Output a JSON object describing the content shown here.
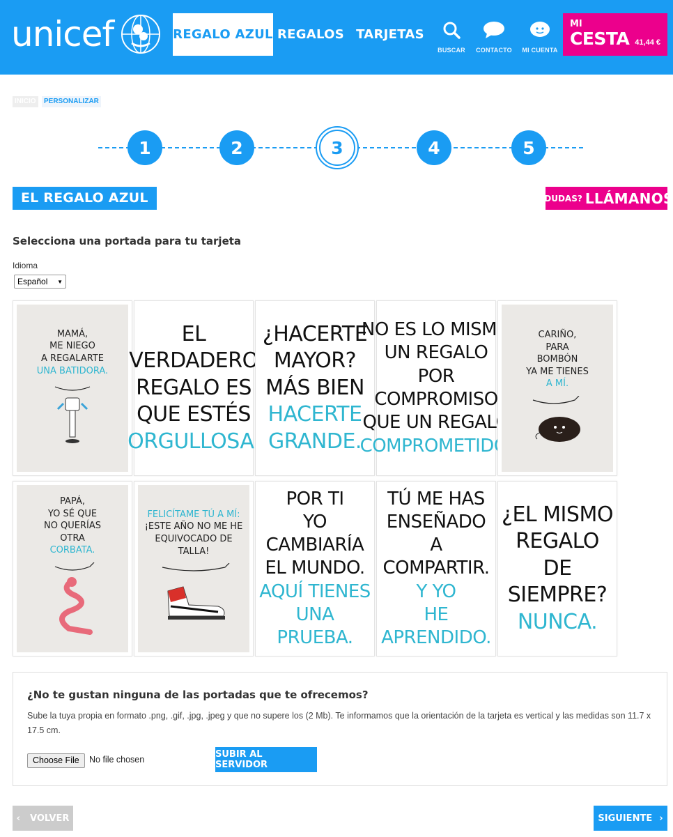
{
  "header": {
    "logo_text": "unicef",
    "nav": [
      {
        "label": "REGALO AZUL",
        "active": true
      },
      {
        "label": "REGALOS",
        "active": false
      },
      {
        "label": "TARJETAS",
        "active": false
      }
    ],
    "icons": [
      {
        "icon": "search-icon",
        "label": "BUSCAR"
      },
      {
        "icon": "chat-icon",
        "label": "CONTACTO"
      },
      {
        "icon": "user-icon",
        "label": "MI CUENTA"
      }
    ],
    "cart": {
      "mi": "MI",
      "cesta": "CESTA",
      "total": "41,44 €"
    },
    "colors": {
      "primary": "#1a9cf3",
      "accent": "#ec008c"
    }
  },
  "breadcrumb": [
    "INICIO",
    "PERSONALIZAR"
  ],
  "steps": {
    "items": [
      "1",
      "2",
      "3",
      "4",
      "5"
    ],
    "current": 3
  },
  "section": {
    "title": "EL REGALO AZUL",
    "help_small": "¿DUDAS?",
    "help_big": "LLÁMANOS",
    "subtitle": "Selecciona una portada para tu tarjeta",
    "language_label": "Idioma",
    "language_value": "Español"
  },
  "cards": [
    {
      "style": "small",
      "bg": "gray",
      "lines": [
        "MAMÁ,",
        "ME NIEGO",
        "A REGALARTE"
      ],
      "blue": [
        "UNA BATIDORA."
      ],
      "illustration": "mixer-icon"
    },
    {
      "style": "big",
      "bg": "white",
      "lines": [
        "EL VERDADERO",
        "REGALO ES",
        "QUE ESTÉS"
      ],
      "blue": [
        "ORGULLOSA."
      ]
    },
    {
      "style": "big",
      "bg": "white",
      "lines": [
        "¿HACERTE",
        "MAYOR?",
        "MÁS BIEN"
      ],
      "blue": [
        "HACERTE",
        "GRANDE."
      ]
    },
    {
      "style": "bigsm",
      "bg": "white",
      "lines": [
        "NO ES LO MISMO",
        "UN REGALO",
        "POR COMPROMISO",
        "QUE UN REGALO"
      ],
      "blue": [
        "COMPROMETIDO."
      ]
    },
    {
      "style": "small",
      "bg": "gray",
      "lines": [
        "CARIÑO,",
        "PARA",
        "BOMBÓN",
        "YA ME TIENES"
      ],
      "blue": [
        "A MÍ."
      ],
      "illustration": "chocolate-icon"
    },
    {
      "style": "small",
      "bg": "gray",
      "lines": [
        "PAPÁ,",
        "YO SÉ QUE",
        "NO QUERÍAS",
        "OTRA"
      ],
      "blue": [
        "CORBATA."
      ],
      "illustration": "tie-icon"
    },
    {
      "style": "small",
      "bg": "gray",
      "lines_pre_blue": [
        "FELICÍTAME TÚ A MÍ:"
      ],
      "lines": [
        "¡ESTE AÑO NO ME HE",
        "EQUIVOCADO DE TALLA!"
      ],
      "blue": [],
      "illustration": "sneaker-icon"
    },
    {
      "style": "bigsm",
      "bg": "white",
      "lines": [
        "POR TI",
        "YO CAMBIARÍA",
        "EL MUNDO."
      ],
      "blue": [
        "AQUÍ TIENES",
        "UNA PRUEBA."
      ]
    },
    {
      "style": "bigsm",
      "bg": "white",
      "lines": [
        "TÚ ME HAS",
        "ENSEÑADO",
        "A COMPARTIR."
      ],
      "blue": [
        "Y YO",
        "HE APRENDIDO."
      ]
    },
    {
      "style": "big",
      "bg": "white",
      "lines": [
        "¿EL MISMO",
        "REGALO",
        "DE SIEMPRE?"
      ],
      "blue": [
        "NUNCA."
      ]
    }
  ],
  "upload": {
    "question": "¿No te gustan ninguna de las portadas que te ofrecemos?",
    "description": "Sube la tuya propia en formato .png, .gif, .jpg, .jpeg y que no supere los (2 Mb). Te informamos que la orientación de la tarjeta es vertical y las medidas son 11.7 x 17.5 cm.",
    "file_button": "Choose File",
    "file_status": "No file chosen",
    "upload_button": "SUBIR AL SERVIDOR"
  },
  "footer": {
    "back": "VOLVER",
    "next": "SIGUIENTE"
  }
}
